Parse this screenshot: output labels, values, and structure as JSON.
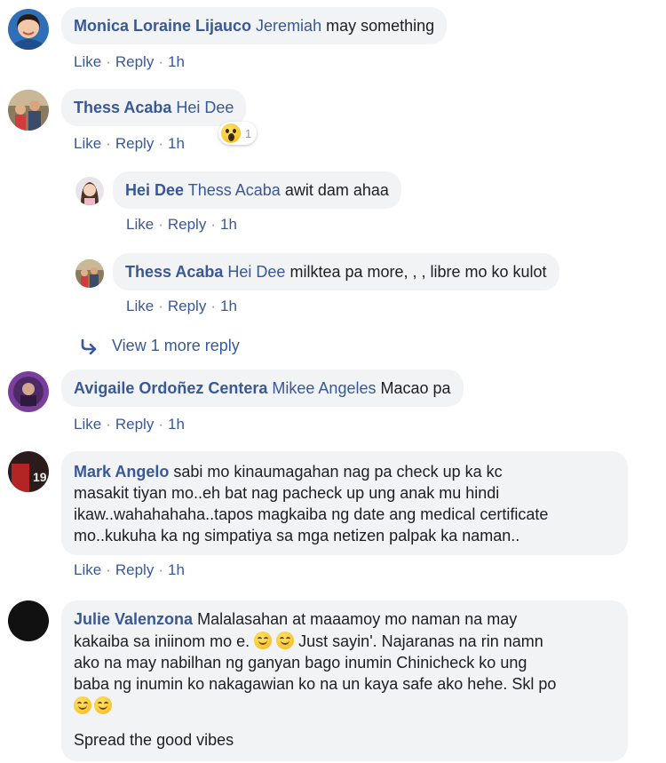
{
  "comments": [
    {
      "author": "Monica Loraine Lijauco",
      "mention": "Jeremiah",
      "text": "may something",
      "avatar": "avatar-woman-photo",
      "like": "Like",
      "reply": "Reply",
      "time": "1h"
    },
    {
      "author": "Thess Acaba",
      "mention": "Hei Dee",
      "text": "",
      "avatar": "avatar-family-photo",
      "like": "Like",
      "reply": "Reply",
      "time": "1h",
      "reaction": {
        "icon": "wow-emoji-icon",
        "count": "1"
      }
    },
    {
      "author": "Hei Dee",
      "mention": "Thess Acaba",
      "text": "awit dam ahaa",
      "avatar": "avatar-girl-photo",
      "like": "Like",
      "reply": "Reply",
      "time": "1h"
    },
    {
      "author": "Thess Acaba",
      "mention": "Hei Dee",
      "text": "milktea pa more, , , libre mo ko kulot",
      "avatar": "avatar-family-photo",
      "like": "Like",
      "reply": "Reply",
      "time": "1h"
    },
    {
      "author": "Avigaile Ordoñez Centera",
      "mention": "Mikee Angeles",
      "text": "Macao pa",
      "avatar": "avatar-purple-photo",
      "like": "Like",
      "reply": "Reply",
      "time": "1h"
    },
    {
      "author": "Mark Angelo",
      "mention": "",
      "text_lines": [
        "sabi mo kinaumagahan nag pa check up ka kc",
        "masakit tiyan mo..eh bat nag pacheck up ung anak mu hindi",
        "ikaw..wahahahaha..tapos magkaiba ng date ang medical certificate",
        "mo..kukuha ka ng simpatiya sa mga netizen palpak ka naman.."
      ],
      "avatar": "avatar-jersey-photo",
      "like": "Like",
      "reply": "Reply",
      "time": "1h"
    },
    {
      "author": "Julie Valenzona",
      "mention": "",
      "line1": "Malalasahan at maaamoy mo naman na may",
      "line2_text": "kakaiba sa iniinom mo e.",
      "line2_after": "Just sayin'. Najaranas na rin namn",
      "line3": "ako na may nabilhan ng ganyan bago inumin Chinicheck ko ung",
      "line4": "baba ng inumin ko nakagawian ko na un kaya safe ako hehe. Skl po",
      "line6": "Spread the good vibes",
      "emoji": "smiling-face-emoji",
      "avatar": "avatar-dark-photo"
    }
  ],
  "view_more": {
    "label": "View 1 more reply",
    "icon": "reply-arrow-icon"
  },
  "colors": {
    "link": "#385898",
    "bubble": "#f2f3f5",
    "text": "#1c1e21",
    "meta": "#90949c"
  }
}
